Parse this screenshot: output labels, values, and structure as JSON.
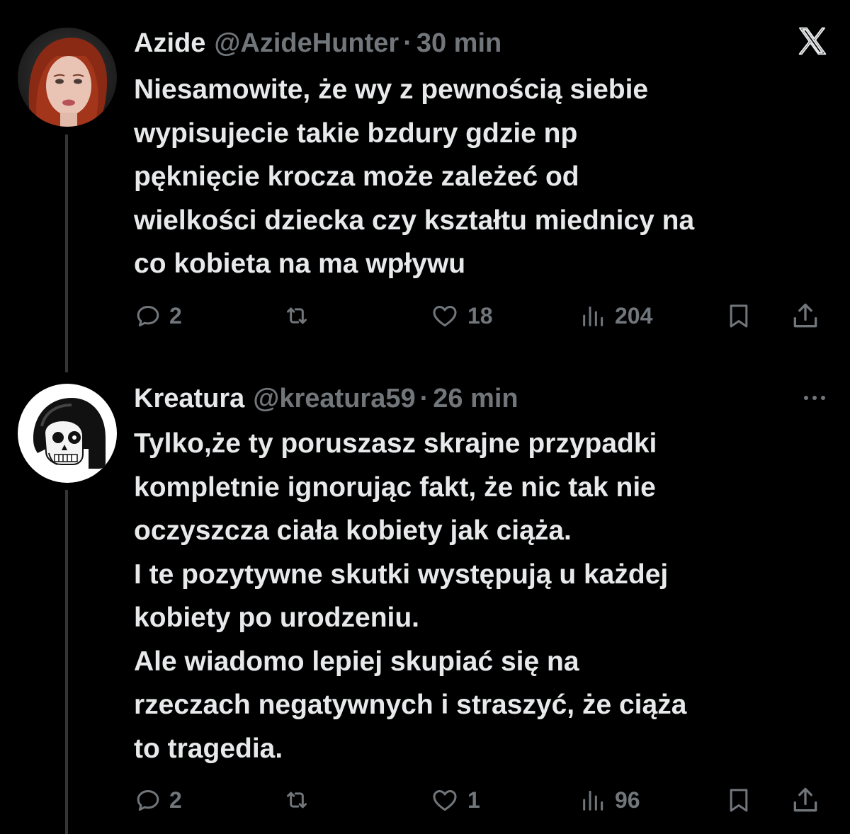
{
  "tweets": [
    {
      "display_name": "Azide",
      "handle": "@AzideHunter",
      "separator": "·",
      "time": "30 min",
      "text_lines": [
        "Niesamowite, że wy z pewnością siebie",
        "wypisujecie takie bzdury gdzie np",
        "pęknięcie krocza może zależeć od",
        "wielkości dziecka czy kształtu miednicy na",
        "co kobieta na ma wpływu"
      ],
      "replies": "2",
      "reposts": "",
      "likes": "18",
      "views": "204"
    },
    {
      "display_name": "Kreatura",
      "handle": "@kreatura59",
      "separator": "·",
      "time": "26 min",
      "text_lines": [
        "Tylko,że ty poruszasz skrajne przypadki",
        "kompletnie ignorując fakt, że nic tak nie",
        "oczyszcza ciała kobiety jak ciąża.",
        "I te pozytywne skutki występują u każdej",
        "kobiety po urodzeniu.",
        "Ale wiadomo lepiej skupiać się na",
        "rzeczach negatywnych i straszyć, że ciąża",
        "to tragedia."
      ],
      "replies": "2",
      "reposts": "",
      "likes": "1",
      "views": "96"
    }
  ],
  "icons": {
    "brand": "x-logo-icon",
    "more": "more-dots-icon",
    "reply": "reply-icon",
    "repost": "repost-icon",
    "like": "heart-icon",
    "views": "views-chart-icon",
    "bookmark": "bookmark-icon",
    "share": "share-icon"
  },
  "colors": {
    "background": "#000000",
    "primary_text": "#e7e9ea",
    "secondary_text": "#71767b",
    "thread_line": "#333639"
  }
}
